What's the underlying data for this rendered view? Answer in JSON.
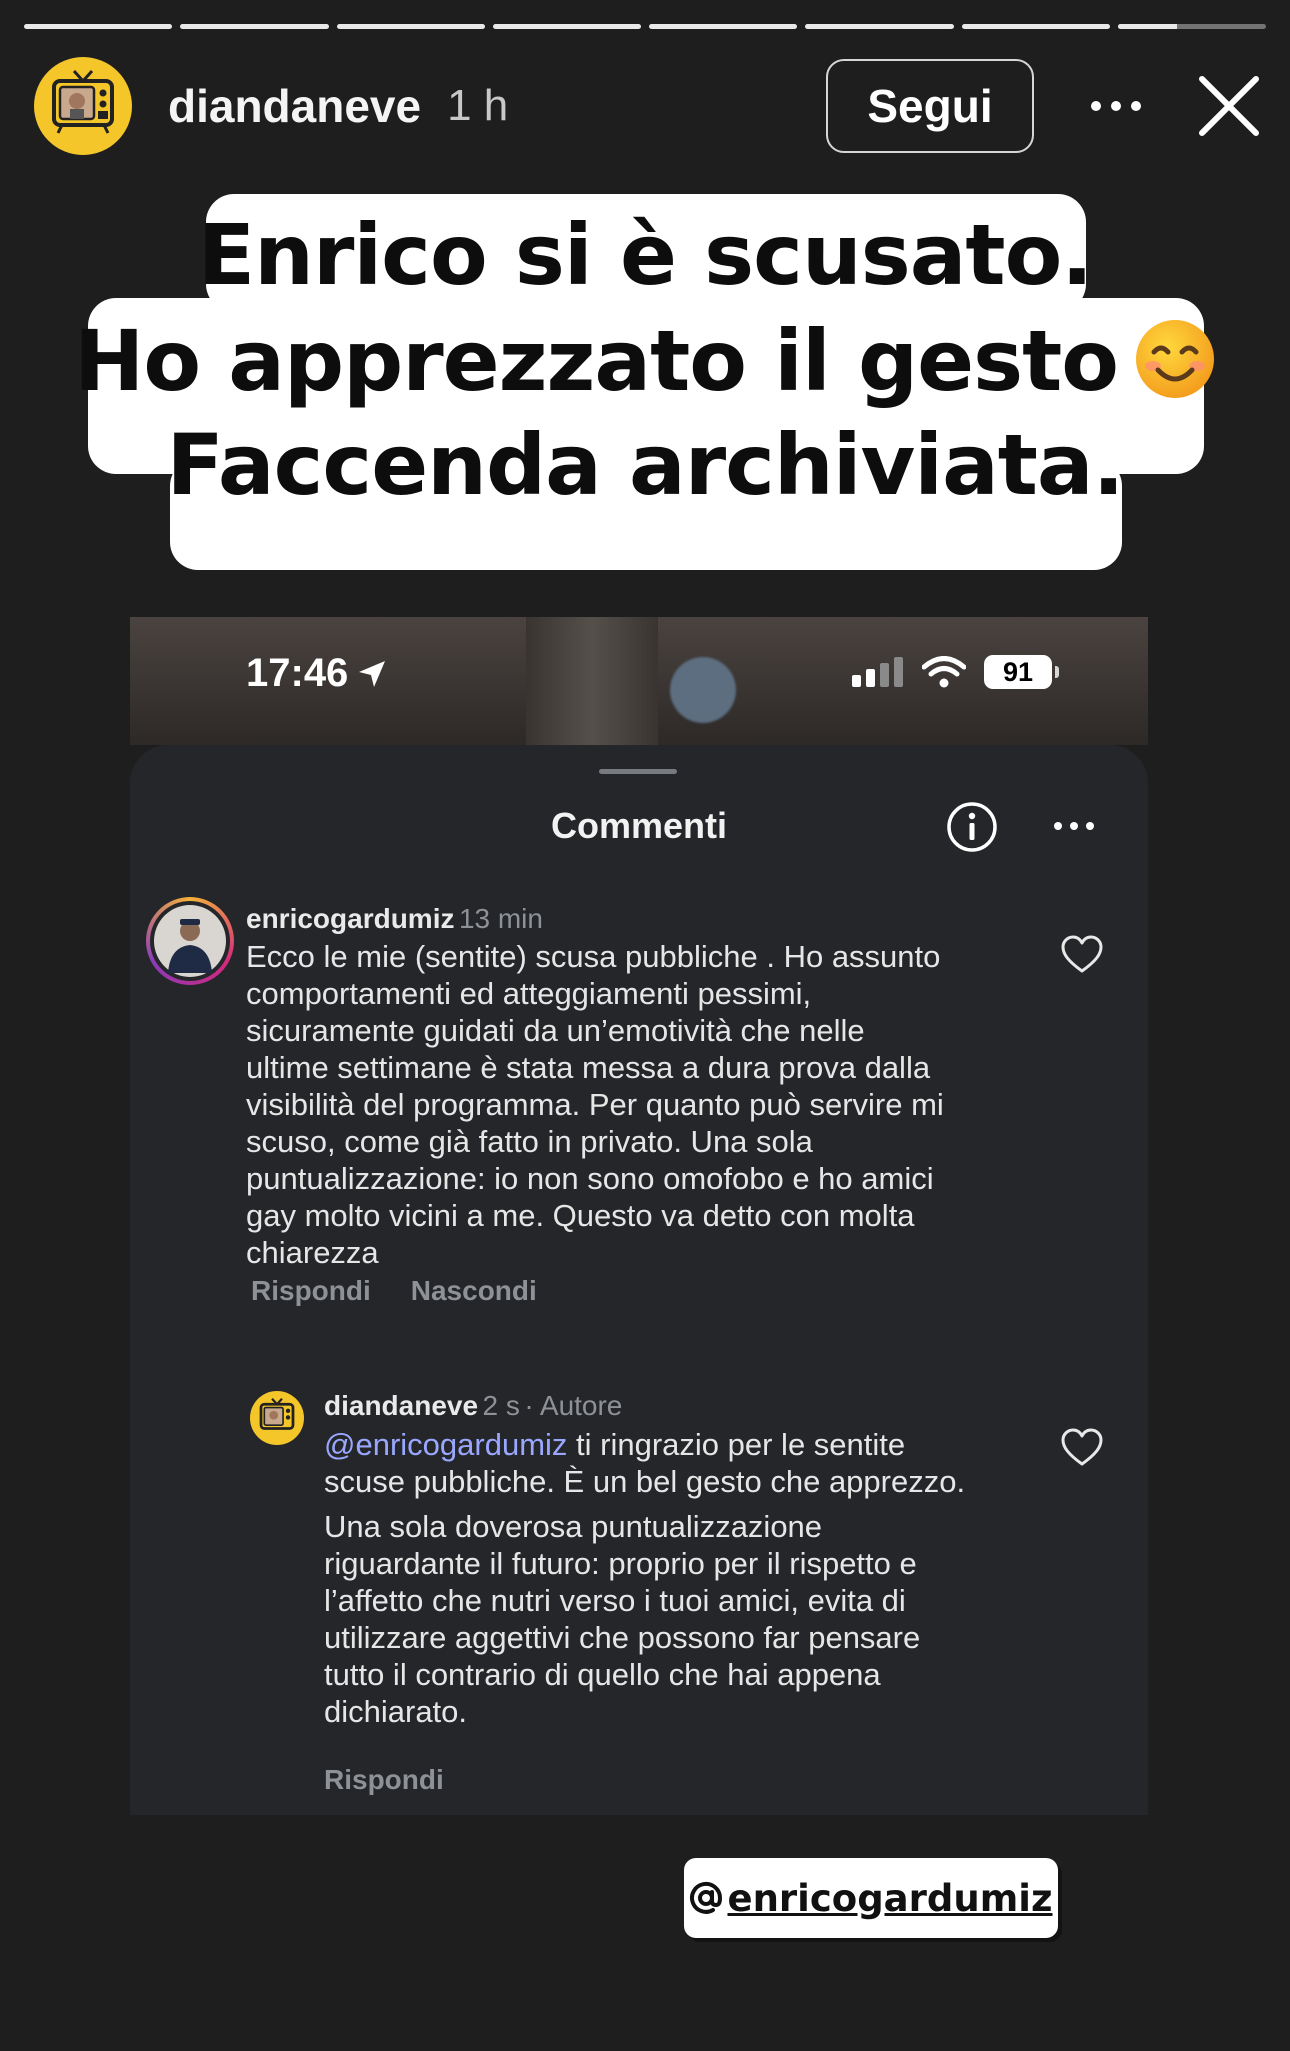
{
  "story": {
    "progress_segments": [
      1,
      1,
      1,
      1,
      1,
      1,
      1,
      0.4
    ],
    "username": "diandaneve",
    "time": "1 h",
    "follow_label": "Segui",
    "caption_lines": [
      "Enrico si è scusato.",
      "Ho apprezzato il gesto",
      "Faccenda archiviata."
    ],
    "caption_emoji": "smiling-face-emoji"
  },
  "screenshot": {
    "status_bar": {
      "time": "17:46",
      "battery": "91"
    },
    "sheet_title": "Commenti",
    "comments": [
      {
        "author": "enricogardumiz",
        "time": "13 min",
        "lines": [
          "Ecco le mie (sentite) scusa pubbliche . Ho assunto",
          "comportamenti ed atteggiamenti pessimi,",
          "sicuramente guidati da un’emotività che nelle",
          "ultime settimane è stata messa a dura prova dalla",
          "visibilità del programma. Per quanto può servire mi",
          "scuso, come già fatto in privato. Una sola",
          "puntualizzazione: io non sono omofobo e ho amici",
          "gay molto vicini a me. Questo va detto con molta",
          "chiarezza"
        ],
        "actions": [
          "Rispondi",
          "Nascondi"
        ]
      },
      {
        "author": "diandaneve",
        "time": "2 s",
        "role": "· Autore",
        "mention": "@enricogardumiz",
        "lines": [
          "ti ringrazio per le sentite",
          "scuse pubbliche. È un bel gesto che apprezzo.",
          "Una sola doverosa puntualizzazione",
          "riguardante il futuro: proprio per il rispetto e",
          "l’affetto che nutri verso i tuoi amici, evita di",
          "utilizzare aggettivi che possono far pensare",
          "tutto il contrario di quello che hai appena",
          "dichiarato."
        ],
        "actions": [
          "Rispondi"
        ]
      }
    ]
  },
  "sticker": {
    "mention": "enricogardumiz"
  }
}
